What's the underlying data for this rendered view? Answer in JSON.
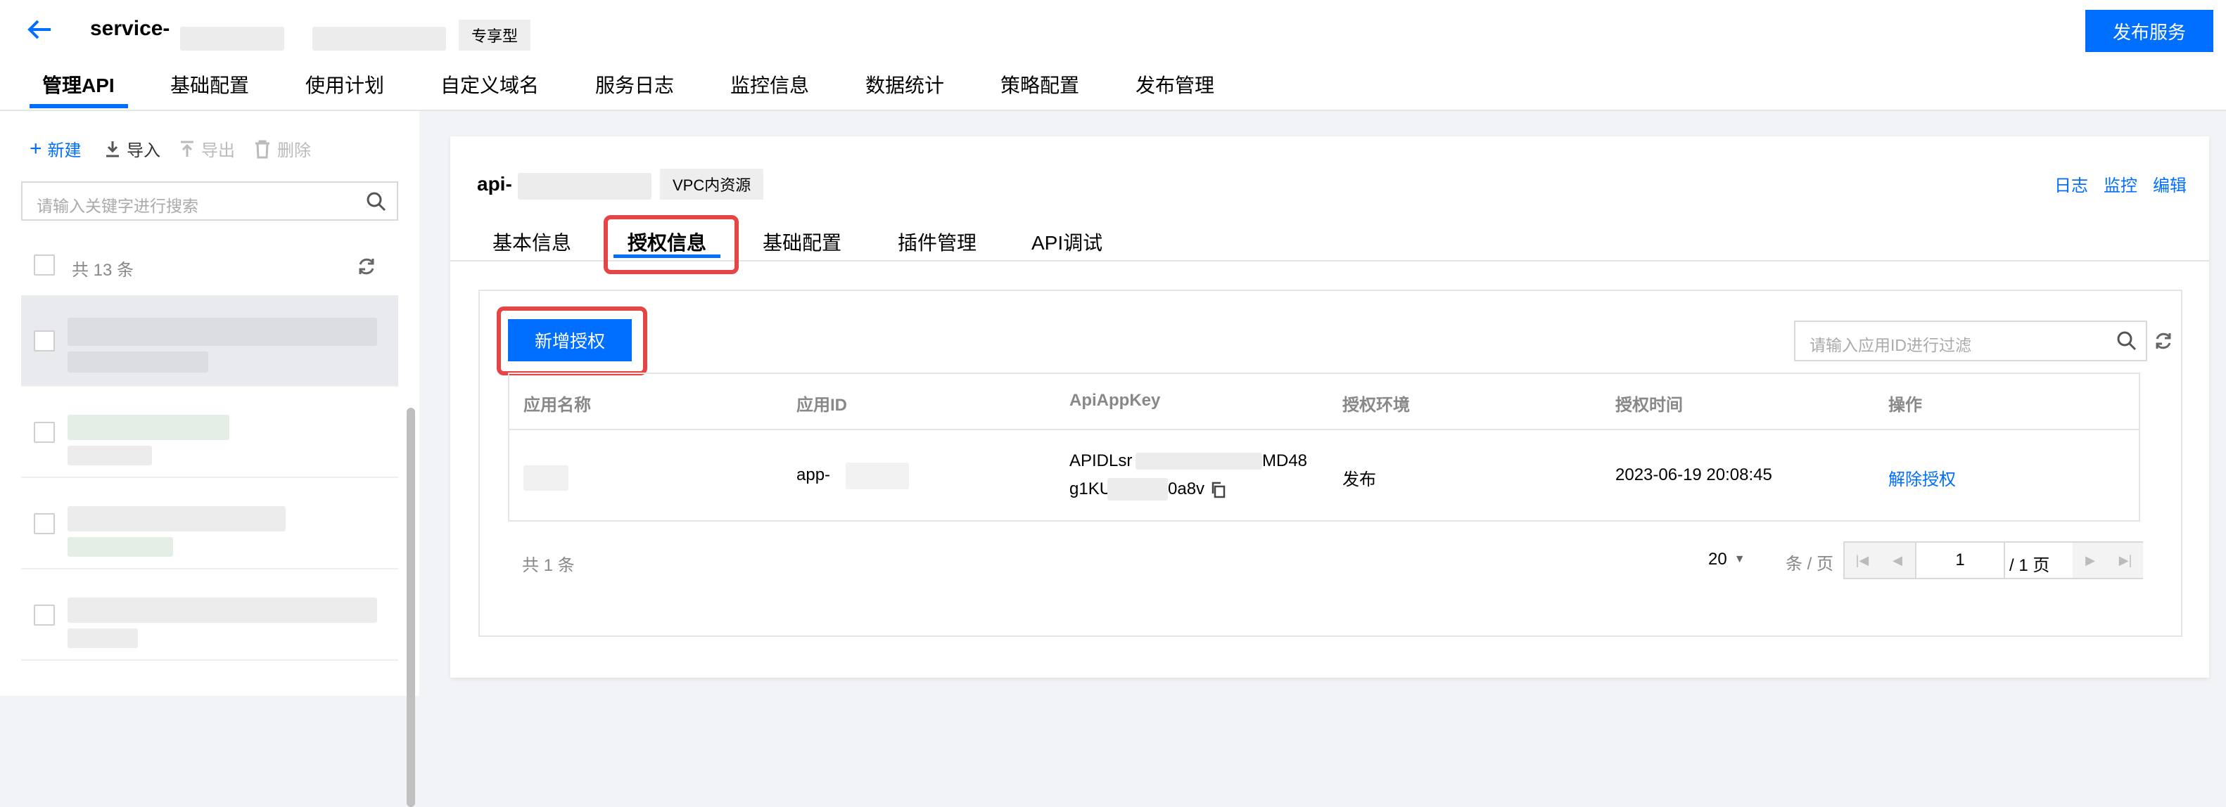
{
  "header": {
    "service_name": "service-",
    "service_type_tag": "专享型",
    "publish_button": "发布服务",
    "nav": [
      "管理API",
      "基础配置",
      "使用计划",
      "自定义域名",
      "服务日志",
      "监控信息",
      "数据统计",
      "策略配置",
      "发布管理"
    ]
  },
  "sidebar": {
    "toolbar": {
      "new": "新建",
      "import": "导入",
      "export": "导出",
      "delete": "删除"
    },
    "search_placeholder": "请输入关键字进行搜索",
    "count_text": "共 13 条"
  },
  "api": {
    "name": "api-",
    "vpc_tag": "VPC内资源",
    "links": {
      "log": "日志",
      "monitor": "监控",
      "edit": "编辑"
    },
    "tabs": [
      "基本信息",
      "授权信息",
      "基础配置",
      "插件管理",
      "API调试"
    ]
  },
  "auth": {
    "add_button": "新增授权",
    "filter_placeholder": "请输入应用ID进行过滤",
    "columns": [
      "应用名称",
      "应用ID",
      "ApiAppKey",
      "授权环境",
      "授权时间",
      "操作"
    ],
    "rows": [
      {
        "app_name": "",
        "app_id": "app-",
        "key_line1_start": "APIDLsr",
        "key_line1_end": "MD48",
        "key_line2_start": "g1KU",
        "key_line2_end": "0a8v",
        "env": "发布",
        "time": "2023-06-19 20:08:45",
        "action": "解除授权"
      }
    ],
    "total": "共 1 条",
    "page_size": "20",
    "page_unit": "条 / 页",
    "current_page": "1",
    "total_pages": "/ 1 页"
  },
  "colors": {
    "primary": "#006eff",
    "highlight": "#e54545"
  }
}
